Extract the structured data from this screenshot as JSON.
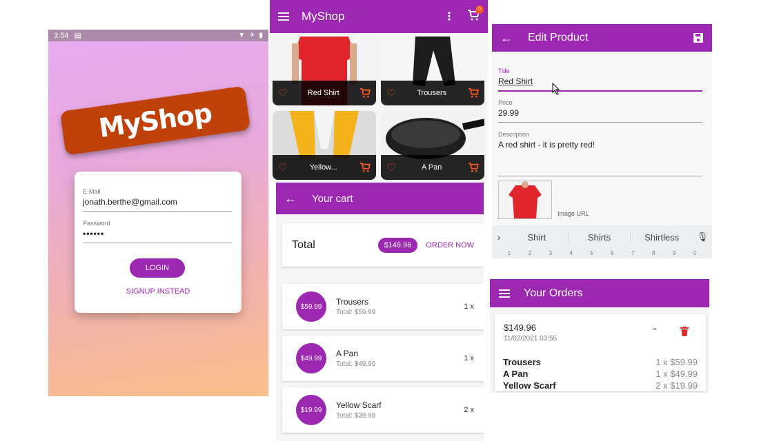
{
  "auth": {
    "status_time": "3:54",
    "logo_text": "MyShop",
    "email_label": "E-Mail",
    "email_value": "jonath.berthe@gmail.com",
    "password_label": "Password",
    "password_value": "••••••",
    "login_label": "LOGIN",
    "signup_label": "SIGNUP INSTEAD"
  },
  "overview": {
    "title": "MyShop",
    "cart_count": "0",
    "products": [
      {
        "name": "Red Shirt"
      },
      {
        "name": "Trousers"
      },
      {
        "name": "Yellow..."
      },
      {
        "name": "A Pan"
      }
    ]
  },
  "cart": {
    "title": "Your cart",
    "total_label": "Total",
    "total_amount": "$149.96",
    "order_now": "ORDER NOW",
    "items": [
      {
        "price": "$59.99",
        "title": "Trousers",
        "total": "Total: $59.99",
        "qty": "1 x"
      },
      {
        "price": "$49.99",
        "title": "A Pan",
        "total": "Total: $49.99",
        "qty": "1 x"
      },
      {
        "price": "$19.99",
        "title": "Yellow Scarf",
        "total": "Total: $39.98",
        "qty": "2 x"
      }
    ]
  },
  "edit": {
    "title": "Edit Product",
    "title_label": "Title",
    "title_value": "Red Shirt",
    "price_label": "Price",
    "price_value": "29.99",
    "description_label": "Description",
    "description_value": "A red shirt - it is pretty red!",
    "image_url_label": "Image URL",
    "suggestions": [
      "Shirt",
      "Shirts",
      "Shirtless"
    ],
    "digits": [
      "1",
      "2",
      "3",
      "4",
      "5",
      "6",
      "7",
      "8",
      "9",
      "0"
    ]
  },
  "orders": {
    "title": "Your Orders",
    "amount": "$149.96",
    "datetime": "11/02/2021 03:55",
    "items": [
      {
        "title": "Trousers",
        "qty": "1 x $59.99"
      },
      {
        "title": "A Pan",
        "qty": "1 x $49.99"
      },
      {
        "title": "Yellow Scarf",
        "qty": "2 x $19.99"
      }
    ]
  },
  "colors": {
    "primary": "#9c27b0",
    "accent": "#ff5722",
    "logo_bg": "#c0420a",
    "delete": "#d32f2f"
  }
}
